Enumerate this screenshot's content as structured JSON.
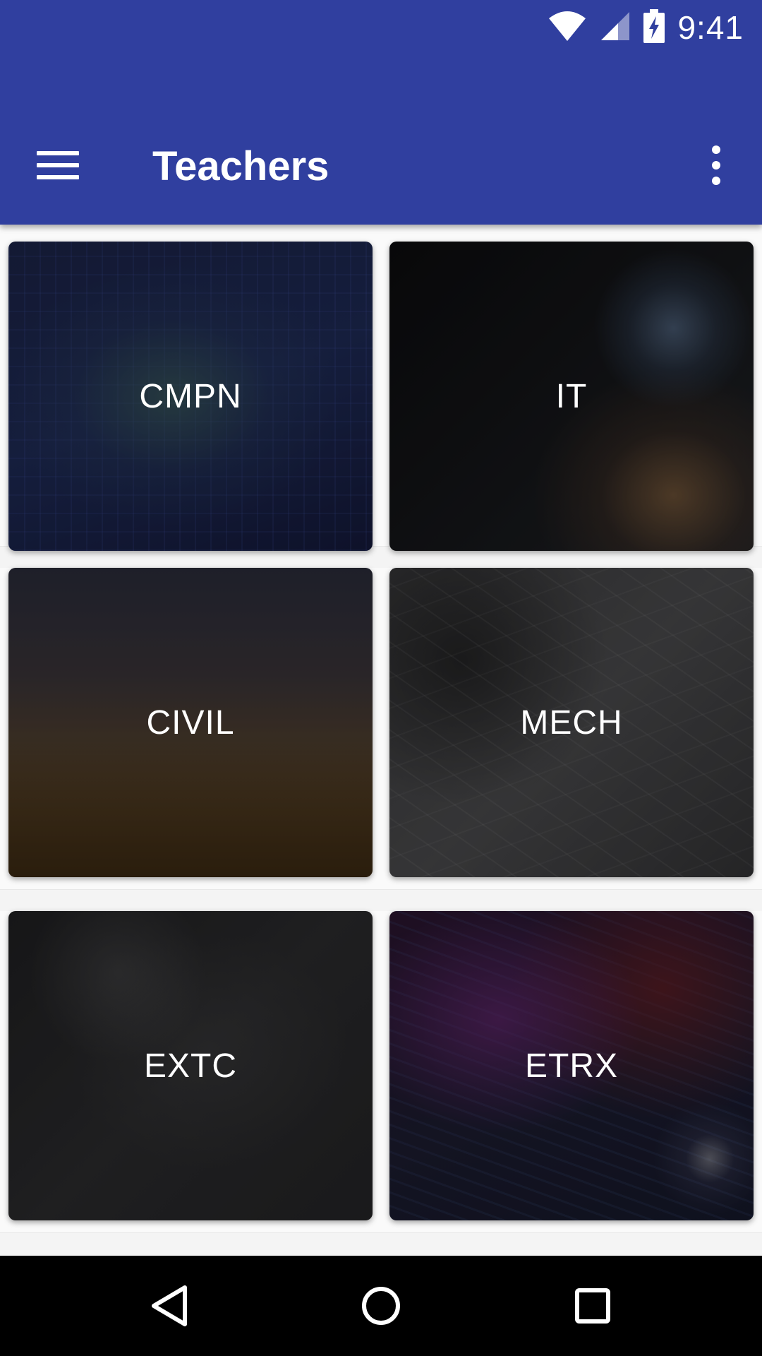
{
  "status_bar": {
    "time": "9:41",
    "icons": [
      "wifi-icon",
      "signal-icon",
      "battery-charging-icon"
    ]
  },
  "app_bar": {
    "title": "Teachers",
    "color": "#303f9f",
    "menu_icon": "hamburger-menu-icon",
    "overflow_icon": "more-vert-icon"
  },
  "departments": [
    {
      "label": "CMPN"
    },
    {
      "label": "IT"
    },
    {
      "label": "CIVIL"
    },
    {
      "label": "MECH"
    },
    {
      "label": "EXTC"
    },
    {
      "label": "ETRX"
    }
  ],
  "nav_bar": {
    "icons": [
      "back-icon",
      "home-icon",
      "recents-icon"
    ]
  }
}
